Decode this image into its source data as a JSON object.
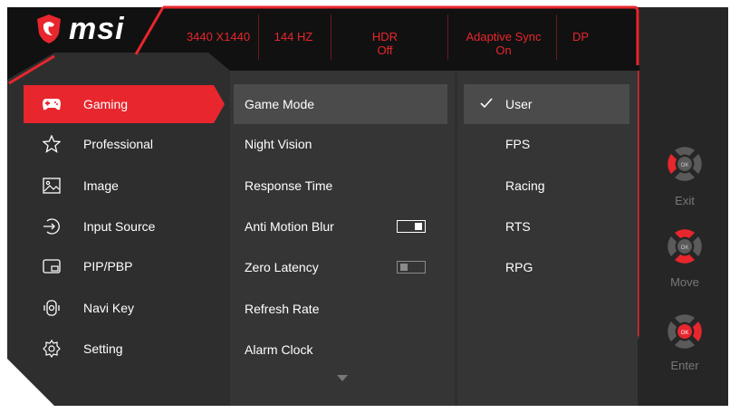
{
  "brand": {
    "name": "msi",
    "logo_icon": "dragon-shield-icon"
  },
  "status_bar": [
    "3440 X1440",
    "144 HZ",
    "HDR\nOff",
    "Adaptive Sync\nOn",
    "DP"
  ],
  "main_menu": [
    {
      "label": "Gaming",
      "icon": "gamepad-icon",
      "active": true
    },
    {
      "label": "Professional",
      "icon": "star-icon",
      "active": false
    },
    {
      "label": "Image",
      "icon": "image-icon",
      "active": false
    },
    {
      "label": "Input Source",
      "icon": "input-source-icon",
      "active": false
    },
    {
      "label": "PIP/PBP",
      "icon": "pip-icon",
      "active": false
    },
    {
      "label": "Navi Key",
      "icon": "navi-key-icon",
      "active": false
    },
    {
      "label": "Setting",
      "icon": "gear-icon",
      "active": false
    }
  ],
  "sub_menu": [
    {
      "label": "Game Mode",
      "active": true
    },
    {
      "label": "Night Vision"
    },
    {
      "label": "Response Time"
    },
    {
      "label": "Anti Motion Blur",
      "toggle": "on"
    },
    {
      "label": "Zero Latency",
      "toggle": "off"
    },
    {
      "label": "Refresh Rate"
    },
    {
      "label": "Alarm Clock"
    }
  ],
  "options": [
    {
      "label": "User",
      "checked": true
    },
    {
      "label": "FPS"
    },
    {
      "label": "Racing"
    },
    {
      "label": "RTS"
    },
    {
      "label": "RPG"
    }
  ],
  "navi_keys": [
    {
      "label": "Exit",
      "icon": "navi-key-left-icon"
    },
    {
      "label": "Move",
      "icon": "navi-key-updown-icon"
    },
    {
      "label": "Enter",
      "icon": "navi-key-press-icon"
    }
  ],
  "colors": {
    "accent": "#e8262d",
    "panel": "#2b2b2b",
    "panel_light": "#3a3a3a",
    "highlight": "#4b4b4b"
  }
}
